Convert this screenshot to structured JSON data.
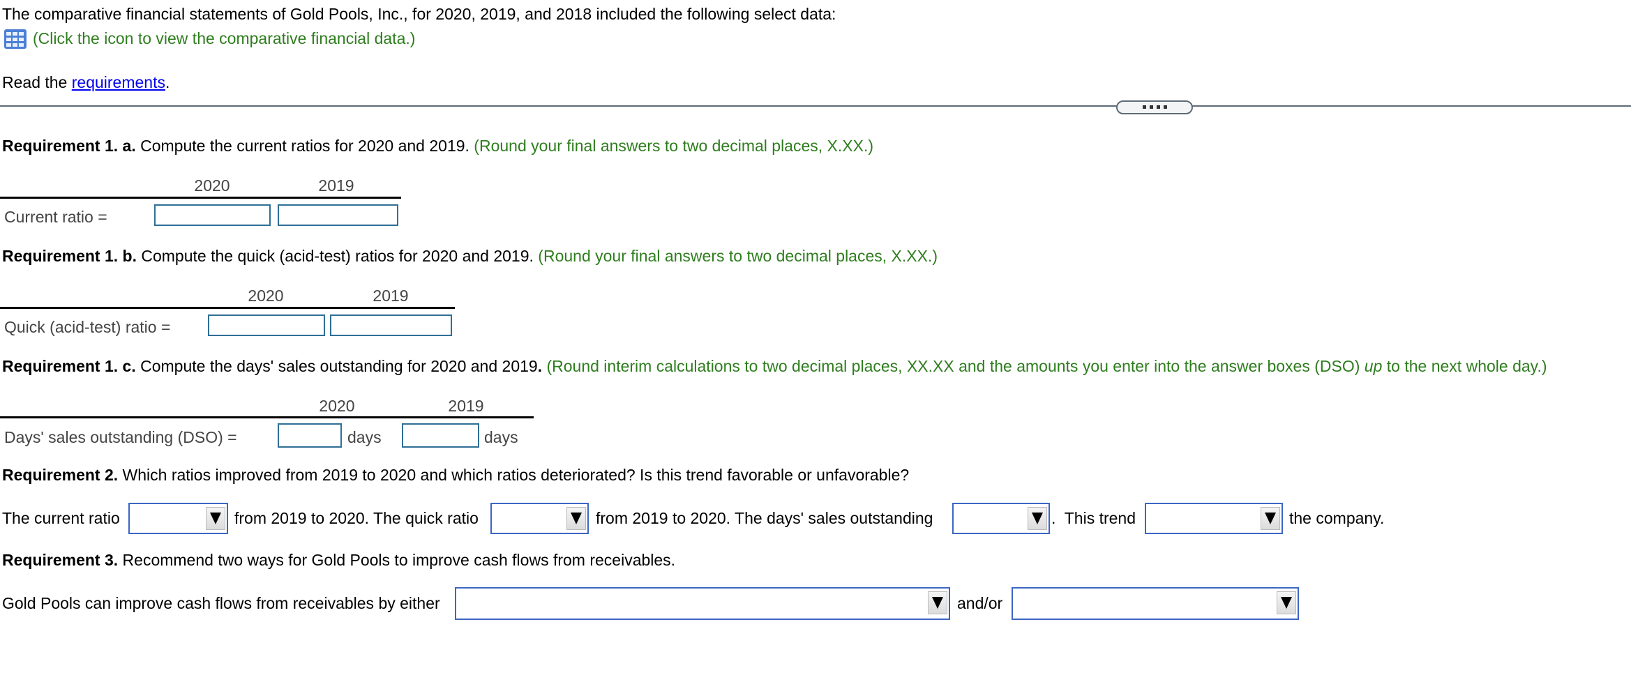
{
  "intro": {
    "text": "The comparative financial statements of Gold Pools, Inc., for 2020, 2019, and 2018 included the following select data:",
    "data_icon": "table-grid-icon",
    "data_hint": "(Click the icon to view the comparative financial data.)",
    "read_prefix": "Read the ",
    "requirements_link": "requirements",
    "read_suffix": "."
  },
  "divider_handle": "resize-handle",
  "req1a": {
    "bold": "Requirement 1. a.",
    "text": " Compute the current ratios for 2020 and 2019.",
    "hint": " (Round your final answers to two decimal places, X.XX.)",
    "years": [
      "2020",
      "2019"
    ],
    "row_label": "Current ratio =",
    "values": [
      "",
      ""
    ]
  },
  "req1b": {
    "bold": "Requirement 1. b.",
    "text": " Compute the quick (acid-test) ratios for 2020 and 2019.",
    "hint": " (Round your final answers to two decimal places, X.XX.)",
    "years": [
      "2020",
      "2019"
    ],
    "row_label": "Quick (acid-test) ratio =",
    "values": [
      "",
      ""
    ]
  },
  "req1c": {
    "bold": "Requirement 1. c.",
    "text": " Compute the days' sales outstanding for 2020 and 2019",
    "bold_period": ".",
    "hint_a": " (Round interim calculations to two decimal places, XX.XX and the amounts you enter into the answer boxes (DSO) ",
    "hint_italic": "up",
    "hint_b": " to the next whole day.)",
    "years": [
      "2020",
      "2019"
    ],
    "row_label": "Days' sales outstanding (DSO) =",
    "unit": "days",
    "values": [
      "",
      ""
    ]
  },
  "req2": {
    "bold": "Requirement 2.",
    "text": " Which ratios improved from 2019 to 2020 and which ratios deteriorated? Is this trend favorable or unfavorable?",
    "s1": "The current ratio",
    "s2": "from 2019 to 2020. The quick ratio",
    "s3": "from 2019 to 2020. The days' sales outstanding",
    "s4": ".  This trend",
    "s5": "the company.",
    "selects": [
      "",
      "",
      "",
      ""
    ]
  },
  "req3": {
    "bold": "Requirement 3.",
    "text": " Recommend two ways for Gold Pools to improve cash flows from receivables.",
    "s1": "Gold Pools can improve cash flows from receivables by either",
    "s2": "and/or",
    "selects": [
      "",
      ""
    ]
  }
}
